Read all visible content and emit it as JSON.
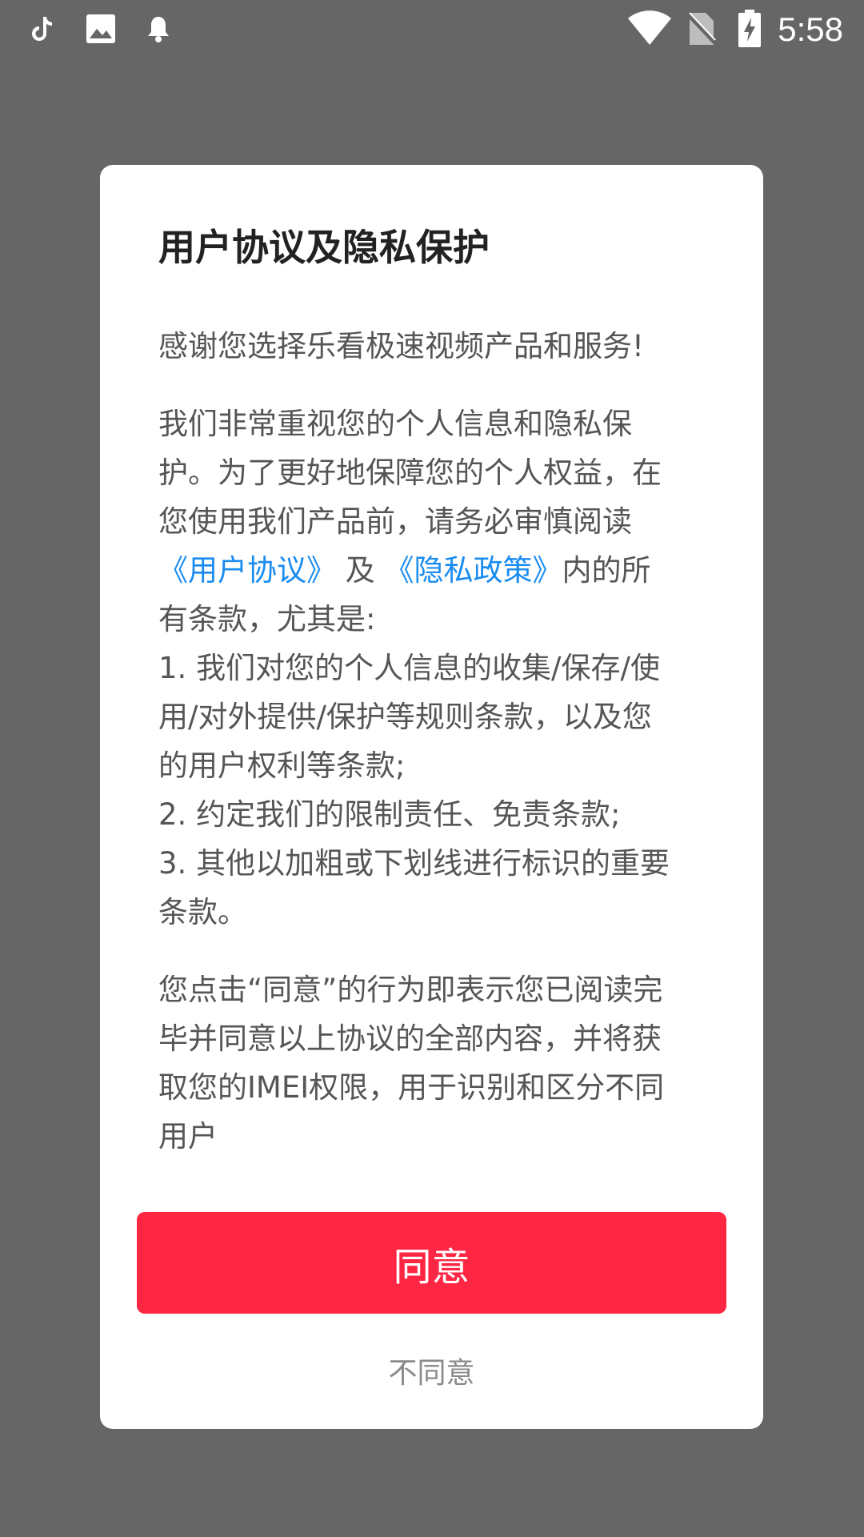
{
  "status_bar": {
    "time": "5:58",
    "left_icons": [
      "tiktok-icon",
      "image-icon",
      "bell-icon"
    ],
    "right_icons": [
      "wifi-icon",
      "no-sim-icon",
      "battery-charging-icon"
    ]
  },
  "dialog": {
    "title": "用户协议及隐私保护",
    "greeting": "感谢您选择乐看极速视频产品和服务!",
    "body": {
      "line1": "我们非常重视您的个人信息和隐私保",
      "line2": "护。为了更好地保障您的个人权益，在",
      "line3": "您使用我们产品前，请务必审慎阅读",
      "user_agreement_link": "《用户协议》",
      "and_text": " 及 ",
      "privacy_policy_link": "《隐私政策》",
      "after_links": "内的所",
      "line5": "有条款，尤其是:",
      "line6": "1. 我们对您的个人信息的收集/保存/使",
      "line7": "用/对外提供/保护等规则条款，以及您",
      "line8": "的用户权利等条款;",
      "line9": "2. 约定我们的限制责任、免责条款;",
      "line10": "3. 其他以加粗或下划线进行标识的重要",
      "line11": "条款。"
    },
    "consent": {
      "line1": "您点击“同意”的行为即表示您已阅读完",
      "line2": "毕并同意以上协议的全部内容，并将获",
      "line3": "取您的IMEI权限，用于识别和区分不同",
      "line4": "用户"
    },
    "agree_label": "同意",
    "disagree_label": "不同意"
  },
  "colors": {
    "overlay": "#666666",
    "accent": "#fd2643",
    "link": "#1a8cf0"
  }
}
